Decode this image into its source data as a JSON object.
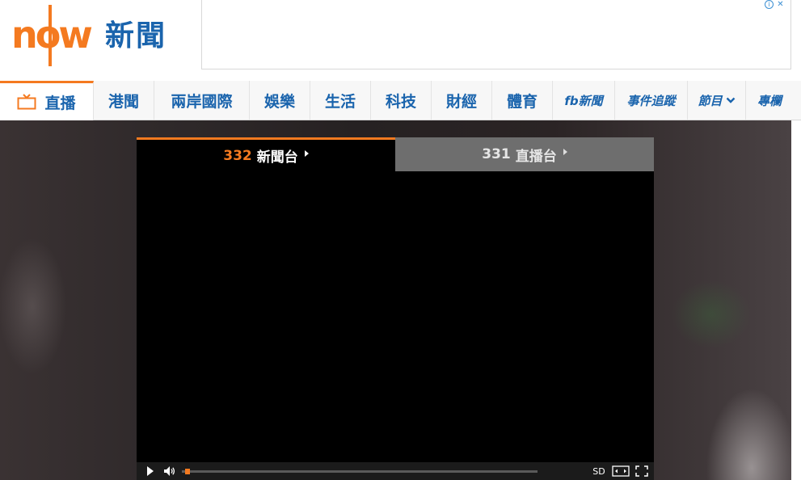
{
  "logo": {
    "word": "now",
    "news": "新聞"
  },
  "ad": {
    "info_glyph": "i",
    "close_glyph": "✕"
  },
  "nav": {
    "items": [
      {
        "label": "直播",
        "icon": "tv-icon",
        "active": true
      },
      {
        "label": "港聞"
      },
      {
        "label": "兩岸國際"
      },
      {
        "label": "娛樂"
      },
      {
        "label": "生活"
      },
      {
        "label": "科技"
      },
      {
        "label": "財經"
      },
      {
        "label": "體育"
      },
      {
        "label": "fb新聞"
      },
      {
        "label": "事件追蹤"
      },
      {
        "label": "節目"
      },
      {
        "label": "專欄"
      }
    ]
  },
  "player": {
    "tabs": [
      {
        "num": "332",
        "name": "新聞台",
        "active": true
      },
      {
        "num": "331",
        "name": "直播台",
        "active": false
      }
    ],
    "quality": "SD",
    "progress": 0.01
  },
  "colors": {
    "accent": "#f47a20",
    "brand_blue": "#1a64ad"
  }
}
